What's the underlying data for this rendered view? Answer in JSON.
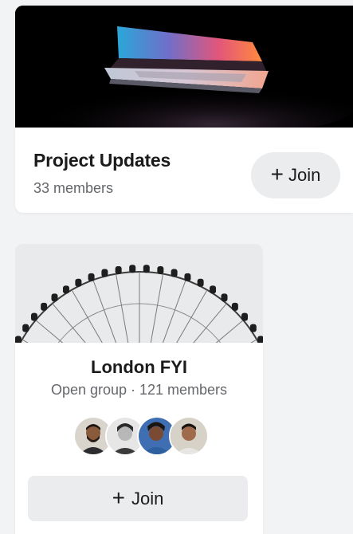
{
  "groups": [
    {
      "name": "Project Updates",
      "members": "33 members",
      "join_label": "Join",
      "join_icon": "+"
    },
    {
      "name": "London FYI",
      "meta": "Open group · 121 members",
      "join_label": "Join",
      "join_icon": "+",
      "member_avatars": [
        "avatar-1",
        "avatar-2",
        "avatar-3",
        "avatar-4"
      ]
    }
  ],
  "colors": {
    "page_background": "#f2f3f5",
    "card": "#ffffff",
    "button": "#ebecee",
    "primary_text": "#1b1b1b",
    "secondary_text": "#65676b"
  }
}
